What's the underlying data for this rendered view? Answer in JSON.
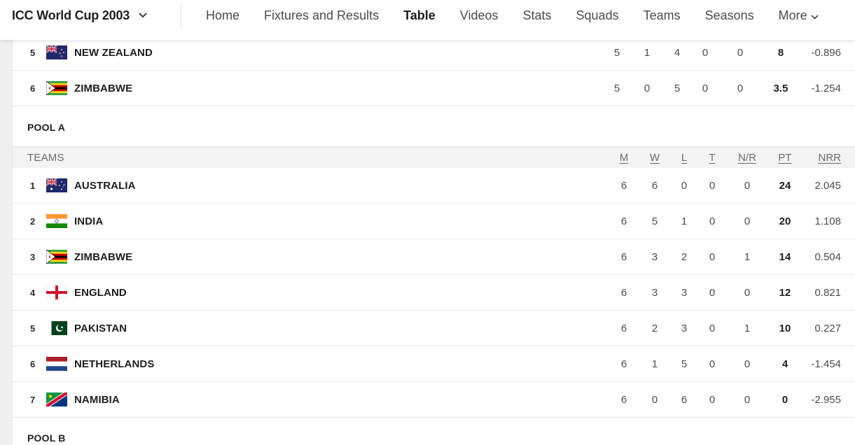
{
  "header": {
    "series_title": "ICC World Cup 2003",
    "nav": [
      "Home",
      "Fixtures and Results",
      "Table",
      "Videos",
      "Stats",
      "Squads",
      "Teams",
      "Seasons",
      "More"
    ],
    "active_nav": "Table"
  },
  "previous_rows": [
    {
      "rank": "5",
      "flag": "new-zealand-flag",
      "team": "NEW ZEALAND",
      "m": "5",
      "w": "1",
      "l": "4",
      "t": "0",
      "nr": "0",
      "pt": "8",
      "nrr": "-0.896"
    },
    {
      "rank": "6",
      "flag": "zimbabwe-flag",
      "team": "ZIMBABWE",
      "m": "5",
      "w": "0",
      "l": "5",
      "t": "0",
      "nr": "0",
      "pt": "3.5",
      "nrr": "-1.254"
    }
  ],
  "pool_a": {
    "title": "POOL A",
    "columns": {
      "teams": "TEAMS",
      "m": "M",
      "w": "W",
      "l": "L",
      "t": "T",
      "nr": "N/R",
      "pt": "PT",
      "nrr": "NRR"
    },
    "rows": [
      {
        "rank": "1",
        "flag": "australia-flag",
        "team": "AUSTRALIA",
        "m": "6",
        "w": "6",
        "l": "0",
        "t": "0",
        "nr": "0",
        "pt": "24",
        "nrr": "2.045"
      },
      {
        "rank": "2",
        "flag": "india-flag",
        "team": "INDIA",
        "m": "6",
        "w": "5",
        "l": "1",
        "t": "0",
        "nr": "0",
        "pt": "20",
        "nrr": "1.108"
      },
      {
        "rank": "3",
        "flag": "zimbabwe-flag",
        "team": "ZIMBABWE",
        "m": "6",
        "w": "3",
        "l": "2",
        "t": "0",
        "nr": "1",
        "pt": "14",
        "nrr": "0.504"
      },
      {
        "rank": "4",
        "flag": "england-flag",
        "team": "ENGLAND",
        "m": "6",
        "w": "3",
        "l": "3",
        "t": "0",
        "nr": "0",
        "pt": "12",
        "nrr": "0.821"
      },
      {
        "rank": "5",
        "flag": "pakistan-flag",
        "team": "PAKISTAN",
        "m": "6",
        "w": "2",
        "l": "3",
        "t": "0",
        "nr": "1",
        "pt": "10",
        "nrr": "0.227"
      },
      {
        "rank": "6",
        "flag": "netherlands-flag",
        "team": "NETHERLANDS",
        "m": "6",
        "w": "1",
        "l": "5",
        "t": "0",
        "nr": "0",
        "pt": "4",
        "nrr": "-1.454"
      },
      {
        "rank": "7",
        "flag": "namibia-flag",
        "team": "NAMIBIA",
        "m": "6",
        "w": "0",
        "l": "6",
        "t": "0",
        "nr": "0",
        "pt": "0",
        "nrr": "-2.955"
      }
    ]
  },
  "pool_b": {
    "title": "POOL B"
  },
  "colors": {
    "active_text": "#1d1e20",
    "muted_text": "#4a4b4d",
    "header_bg": "#f3f3f4",
    "divider": "#e8e8ea"
  }
}
